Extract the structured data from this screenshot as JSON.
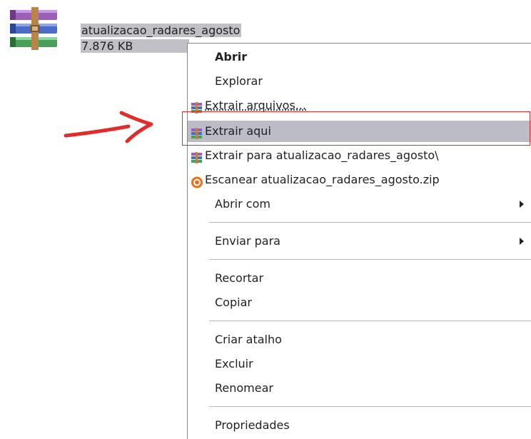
{
  "file": {
    "name": "atualizacao_radares_agosto",
    "size": "7.876 KB",
    "icon": "winrar-archive-icon"
  },
  "menu": {
    "items": [
      {
        "label": "Abrir"
      },
      {
        "label": "Explorar"
      },
      {
        "label": "Extrair arquivos..."
      },
      {
        "label": "Extrair aqui"
      },
      {
        "label": "Extrair para atualizacao_radares_agosto\\"
      },
      {
        "label": "Escanear atualizacao_radares_agosto.zip"
      },
      {
        "label": "Abrir com"
      },
      {
        "label": "Enviar para"
      },
      {
        "label": "Recortar"
      },
      {
        "label": "Copiar"
      },
      {
        "label": "Criar atalho"
      },
      {
        "label": "Excluir"
      },
      {
        "label": "Renomear"
      },
      {
        "label": "Propriedades"
      }
    ]
  },
  "annotation": {
    "color": "#e22b2b"
  },
  "colors": {
    "highlight": "#bcbcc6",
    "selection": "#c0c0c6"
  }
}
